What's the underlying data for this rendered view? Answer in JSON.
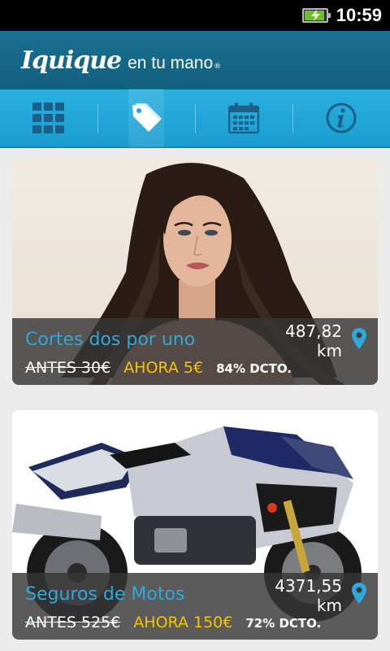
{
  "status_bar": {
    "time": "10:59",
    "battery_icon": "battery-charging-icon"
  },
  "header": {
    "logo_city": "Iquique",
    "logo_rest": "en tu mano",
    "logo_reg": "®"
  },
  "tabs": [
    {
      "icon": "grid-icon",
      "active": false
    },
    {
      "icon": "tag-icon",
      "active": true
    },
    {
      "icon": "calendar-icon",
      "active": false
    },
    {
      "icon": "info-icon",
      "active": false
    }
  ],
  "colors": {
    "accent": "#2fa8dc",
    "price": "#f7c400",
    "tabbar": "#1fa6da",
    "header": "#16678a"
  },
  "offers": [
    {
      "title": "Cortes dos por uno",
      "distance_value": "487,82",
      "distance_unit": "km",
      "old_price": "ANTES 30€",
      "new_price": "AHORA 5€",
      "discount": "84% DCTO.",
      "pin_icon": "map-pin-icon"
    },
    {
      "title": "Seguros de Motos",
      "distance_value": "4371,55",
      "distance_unit": "km",
      "old_price": "ANTES 525€",
      "new_price": "AHORA 150€",
      "discount": "72% DCTO.",
      "pin_icon": "map-pin-icon"
    }
  ]
}
